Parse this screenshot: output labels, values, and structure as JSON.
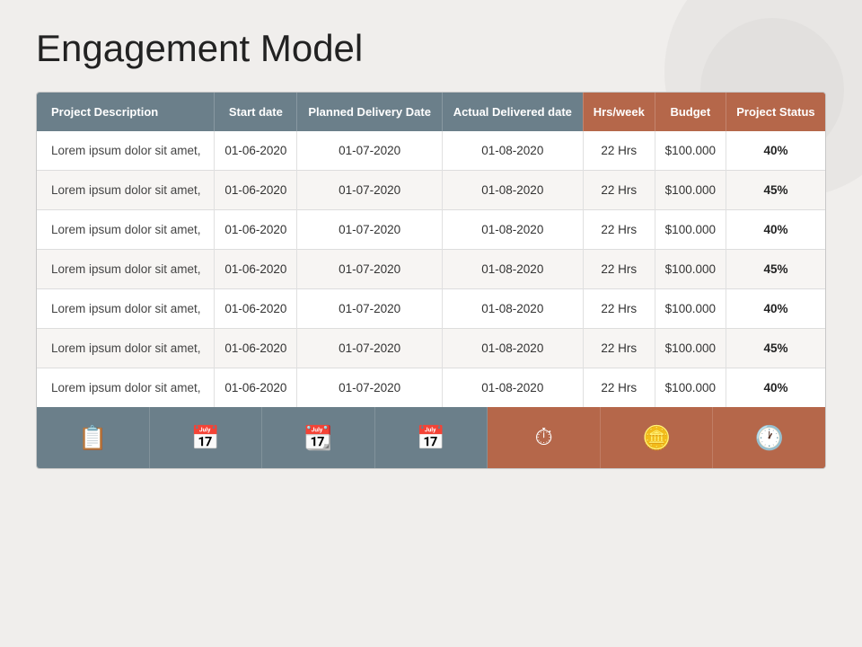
{
  "title": "Engagement Model",
  "table": {
    "headers": [
      {
        "key": "project_description",
        "label": "Project Description",
        "accent": false
      },
      {
        "key": "start_date",
        "label": "Start date",
        "accent": false
      },
      {
        "key": "planned_delivery_date",
        "label": "Planned Delivery Date",
        "accent": false
      },
      {
        "key": "actual_delivered_date",
        "label": "Actual Delivered date",
        "accent": false
      },
      {
        "key": "hrs_week",
        "label": "Hrs/week",
        "accent": true
      },
      {
        "key": "budget",
        "label": "Budget",
        "accent": true
      },
      {
        "key": "project_status",
        "label": "Project Status",
        "accent": true
      }
    ],
    "rows": [
      {
        "project_description": "Lorem ipsum dolor sit amet,",
        "start_date": "01-06-2020",
        "planned_delivery_date": "01-07-2020",
        "actual_delivered_date": "01-08-2020",
        "hrs_week": "22 Hrs",
        "budget": "$100.000",
        "project_status": "40%"
      },
      {
        "project_description": "Lorem ipsum dolor sit amet,",
        "start_date": "01-06-2020",
        "planned_delivery_date": "01-07-2020",
        "actual_delivered_date": "01-08-2020",
        "hrs_week": "22 Hrs",
        "budget": "$100.000",
        "project_status": "45%"
      },
      {
        "project_description": "Lorem ipsum dolor sit amet,",
        "start_date": "01-06-2020",
        "planned_delivery_date": "01-07-2020",
        "actual_delivered_date": "01-08-2020",
        "hrs_week": "22 Hrs",
        "budget": "$100.000",
        "project_status": "40%"
      },
      {
        "project_description": "Lorem ipsum dolor sit amet,",
        "start_date": "01-06-2020",
        "planned_delivery_date": "01-07-2020",
        "actual_delivered_date": "01-08-2020",
        "hrs_week": "22 Hrs",
        "budget": "$100.000",
        "project_status": "45%"
      },
      {
        "project_description": "Lorem ipsum dolor sit amet,",
        "start_date": "01-06-2020",
        "planned_delivery_date": "01-07-2020",
        "actual_delivered_date": "01-08-2020",
        "hrs_week": "22 Hrs",
        "budget": "$100.000",
        "project_status": "40%"
      },
      {
        "project_description": "Lorem ipsum dolor sit amet,",
        "start_date": "01-06-2020",
        "planned_delivery_date": "01-07-2020",
        "actual_delivered_date": "01-08-2020",
        "hrs_week": "22 Hrs",
        "budget": "$100.000",
        "project_status": "45%"
      },
      {
        "project_description": "Lorem ipsum dolor sit amet,",
        "start_date": "01-06-2020",
        "planned_delivery_date": "01-07-2020",
        "actual_delivered_date": "01-08-2020",
        "hrs_week": "22 Hrs",
        "budget": "$100.000",
        "project_status": "40%"
      }
    ],
    "footer_icons": [
      {
        "key": "clipboard-icon",
        "symbol": "📋",
        "accent": false
      },
      {
        "key": "calendar-icon-1",
        "symbol": "📅",
        "accent": false
      },
      {
        "key": "calendar-icon-2",
        "symbol": "📆",
        "accent": false
      },
      {
        "key": "calendar-icon-3",
        "symbol": "📅",
        "accent": false
      },
      {
        "key": "stopwatch-icon",
        "symbol": "⏱",
        "accent": true
      },
      {
        "key": "coins-icon",
        "symbol": "🪙",
        "accent": true
      },
      {
        "key": "gauge-icon",
        "symbol": "🕐",
        "accent": true
      }
    ]
  },
  "colors": {
    "header_bg": "#6b7f8a",
    "accent_bg": "#b5674a",
    "row_odd": "#ffffff",
    "row_even": "#f7f5f3",
    "border": "#ddd"
  }
}
